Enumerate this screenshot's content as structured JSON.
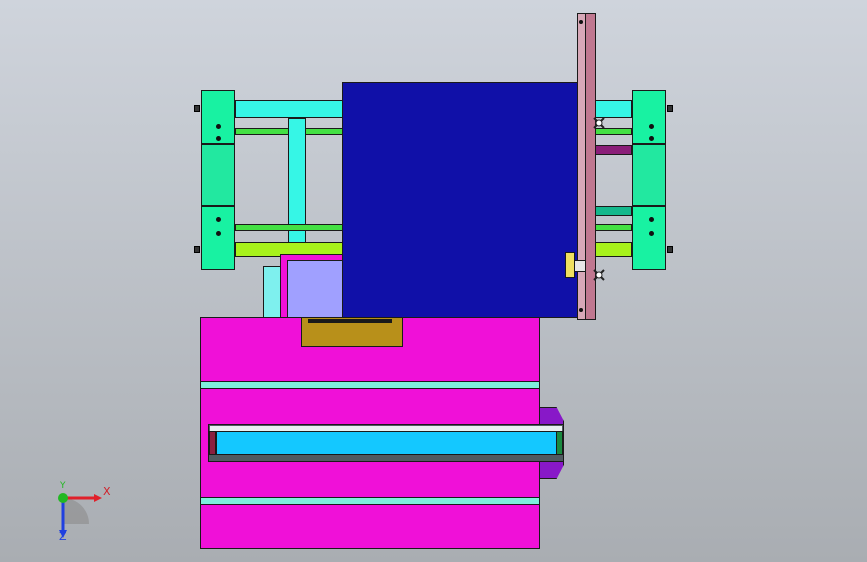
{
  "viewport": {
    "background_top": "#cfd4dc",
    "background_bottom": "#a9adb2"
  },
  "triad": {
    "x_label": "X",
    "y_label": "Y",
    "z_label": "Z",
    "x_color": "#e0202a",
    "y_color": "#22b822",
    "z_color": "#2040e0"
  },
  "colors": {
    "frame_cyan": "#36f6e6",
    "bracket_green": "#18f2a2",
    "rail_green": "#44e044",
    "rail_yellowgreen": "#a8f21c",
    "plate_blue": "#1010a8",
    "rail_pink": "#c07890",
    "base_magenta": "#f010d8",
    "slot_cyan": "#14c8ff",
    "clamp_gold": "#b8901a",
    "block_lavender": "#a0a0ff",
    "motor_purple": "#8818c8"
  }
}
